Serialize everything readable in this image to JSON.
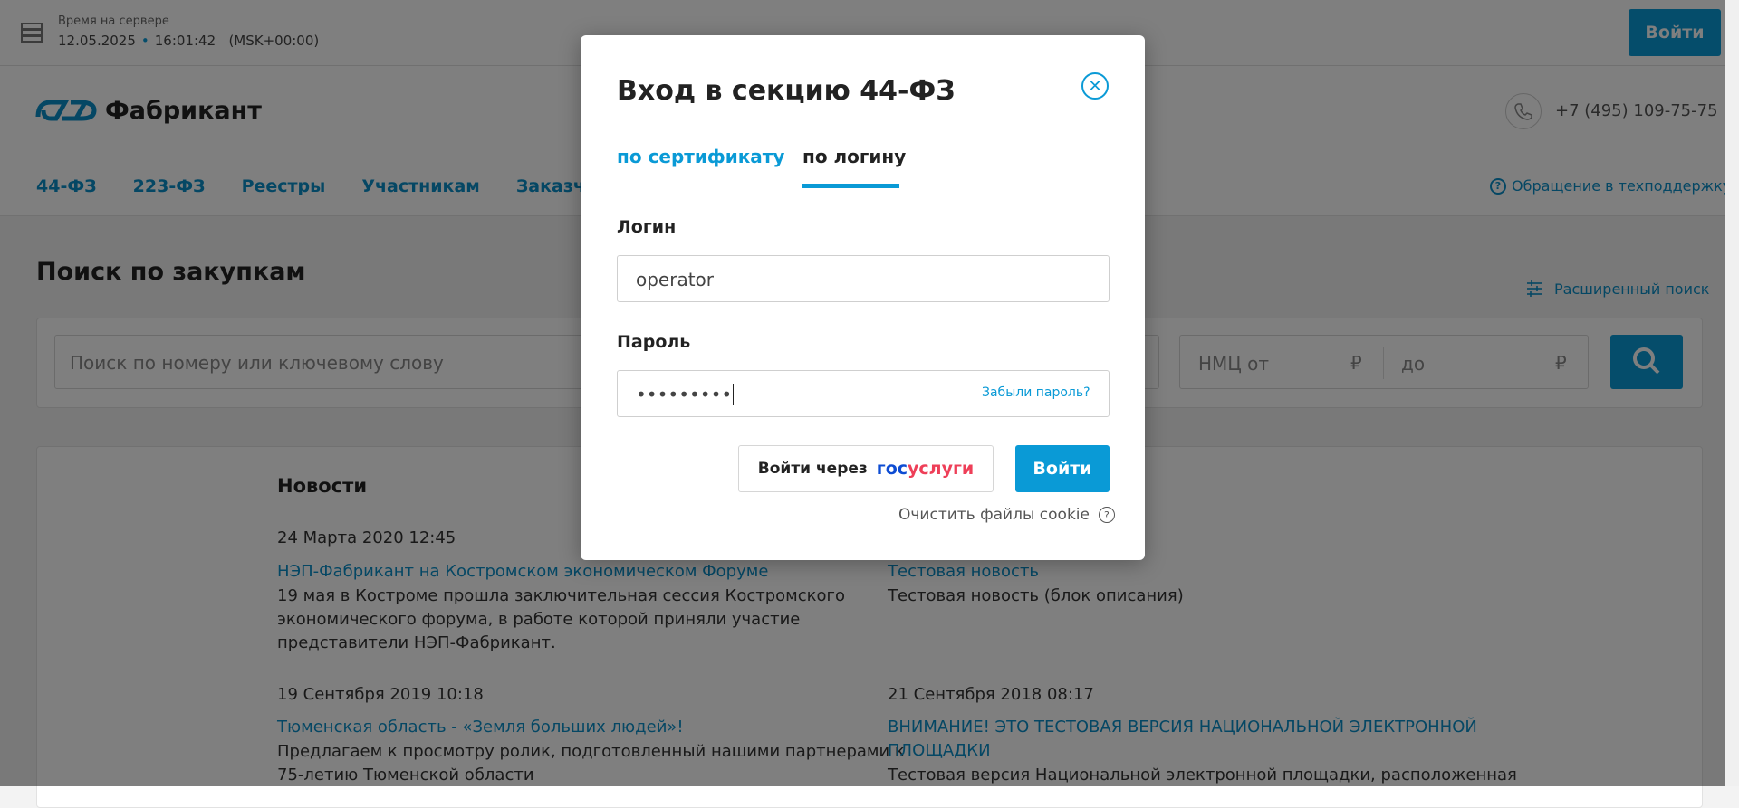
{
  "topbar": {
    "server_time_caption": "Время на сервере",
    "date": "12.05.2025",
    "time": "16:01:42",
    "tz": "(MSK+00:00)",
    "login_button": "Войти"
  },
  "header": {
    "logo_text": "Фабрикант",
    "phone": "+7 (495) 109-75-75",
    "nav": [
      "44-ФЗ",
      "223-ФЗ",
      "Реестры",
      "Участникам",
      "Заказчикам"
    ],
    "support_link": "Обращение в техподдержку"
  },
  "search": {
    "title": "Поиск по закупкам",
    "advanced_link": "Расширенный поиск",
    "placeholder": "Поиск по номеру или ключевому слову",
    "nmc_from": "НМЦ от",
    "nmc_to": "до",
    "currency": "₽"
  },
  "news": {
    "title": "Новости",
    "items": [
      {
        "date": "24 Марта 2020 12:45",
        "title": "НЭП-Фабрикант на Костромском экономическом Форуме",
        "text_lines": [
          "19 мая в Костроме прошла заключительная сессия Костромского",
          "экономического форума, в работе которой приняли участие",
          "представители НЭП-Фабрикант."
        ]
      },
      {
        "date": "",
        "title": "Тестовая новость",
        "text_lines": [
          "Тестовая новость (блок описания)"
        ]
      },
      {
        "date": "19 Сентября 2019 10:18",
        "title": "Тюменская область - «Земля больших людей»!",
        "text_lines": [
          "Предлагаем к просмотру ролик, подготовленный нашими партнерами к",
          "75-летию Тюменской области"
        ]
      },
      {
        "date": "21 Сентября 2018 08:17",
        "title_lines": [
          "ВНИМАНИЕ! ЭТО ТЕСТОВАЯ ВЕРСИЯ НАЦИОНАЛЬНОЙ ЭЛЕКТРОННОЙ",
          "ПЛОЩАДКИ"
        ],
        "text_lines": [
          "Тестовая версия Национальной электронной площадки, расположенная"
        ]
      }
    ]
  },
  "modal": {
    "title": "Вход в секцию 44-ФЗ",
    "tab_certificate": "по сертификату",
    "tab_login": "по логину",
    "login_label": "Логин",
    "login_value": "operator",
    "password_label": "Пароль",
    "password_value": "•••••••••",
    "forgot": "Забыли пароль?",
    "gos_prefix": "Войти через",
    "gos_part1": "гос",
    "gos_part2": "услуги",
    "login_button": "Войти",
    "clear_cookie": "Очистить файлы cookie"
  },
  "colors": {
    "accent": "#0a9ad6",
    "link": "#0a8fc8"
  }
}
